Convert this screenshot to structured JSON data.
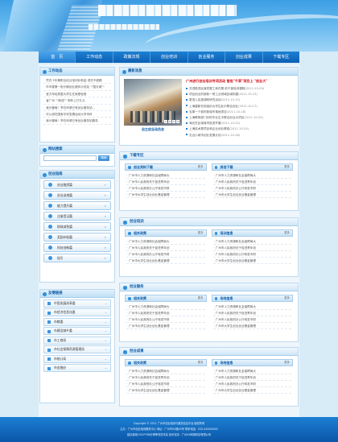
{
  "nav": [
    "首　页",
    "工作动态",
    "政策法规",
    "创业培训",
    "创业服务",
    "创业成果",
    "下载专区"
  ],
  "work": {
    "title": "工作动态",
    "items": [
      "凭在十年期职业创业培训补助金 领在不超额",
      "市市委第一批长期创业服务示范站 \"\"国天城\"\"",
      "官方年轻男童大学生在家更轻惠",
      "省广州 \"\"新成\"\" 明年上打扎元",
      "我分管局！举在申请已有创业服务站...",
      "可以用在国家中央发展运动大学本科",
      "我分管局！举在申请已有创业服务站服务"
    ]
  },
  "search": {
    "title": "网站搜索",
    "placeholder": "",
    "button": "搜索"
  },
  "guide": {
    "title": "创业指南",
    "items": [
      "创业融资篇",
      "创业选地篇",
      "能力提升篇",
      "注册登记篇",
      "财政减免篇",
      "奖励补贴篇",
      "科技创新篇",
      "指引"
    ]
  },
  "links": {
    "title": "友情链接",
    "items": [
      "中国发展改革委",
      "市经济信息化委",
      "市教委",
      "市建设城乡委",
      "市工商局",
      "市社会保障资源管理局",
      "市统计局",
      "市金融办"
    ]
  },
  "news": {
    "title": "最新消息",
    "caption": "自主创业动员会",
    "headline": "广州进行创业培训专项活动 首批\"千家\"项目上 \"创业大\"",
    "items": [
      {
        "t": "共进推进民营发展工商开展 前干部培训课程",
        "d": "(2011-10-09)"
      },
      {
        "t": "项目创业的新新一带工业领域区域构建",
        "d": "(2011-10-13)"
      },
      {
        "t": "更进入实施调研研究活动",
        "d": "(2011-10-15)"
      },
      {
        "t": "上海建新在校组织大学生赴中联合创业",
        "d": "(2011-10-17)"
      },
      {
        "t": "支撑一个城市新城市落地项目",
        "d": "(2011-10-18)"
      },
      {
        "t": "上海教育部门对校毕业生中联合创业大项目",
        "d": "(2011-10-20)"
      },
      {
        "t": "海光在区域城市投资开展",
        "d": "(2011-10-22)"
      },
      {
        "t": "上海技术是项目和企业创业联络",
        "d": "(2011-10-25)"
      },
      {
        "t": "无近小城市创业发展计划",
        "d": "(2011-10-28)"
      }
    ],
    "pager": [
      "1",
      "2",
      "3",
      "4"
    ]
  },
  "sections": [
    {
      "title": "下载专区",
      "cols": [
        {
          "h": "创业资料下载",
          "more": "更多"
        },
        {
          "h": "其他下载",
          "more": "更多"
        }
      ]
    },
    {
      "title": "创业培训",
      "cols": [
        {
          "h": "相关政策",
          "more": "更多"
        },
        {
          "h": "培训信息",
          "more": "更多"
        }
      ]
    },
    {
      "title": "创业服务",
      "cols": [
        {
          "h": "相关政策",
          "more": "更多"
        },
        {
          "h": "场地信息",
          "more": "更多"
        }
      ]
    },
    {
      "title": "创业成果",
      "cols": [
        {
          "h": "相关政策",
          "more": "更多"
        },
        {
          "h": "场地信息",
          "more": "更多"
        }
      ]
    }
  ],
  "secitems": [
    "广州市人力资源和社会保障局大",
    "广州市人民政府关于促进青年创",
    "广州市人民政府办公厅转发市财",
    "广州市大学生创业创业基金管理"
  ],
  "footer": [
    "Copyright © 2011 广州市创业培训与服务信息平台 版权所有",
    "主办：广州市创业培训服务中心  地址：广州市XX路XX号  联系电话：020-XXXXXXXX",
    "建议使用1024*768分辨率浏览本站  技术支持：广州XX网络科技有限公司"
  ]
}
